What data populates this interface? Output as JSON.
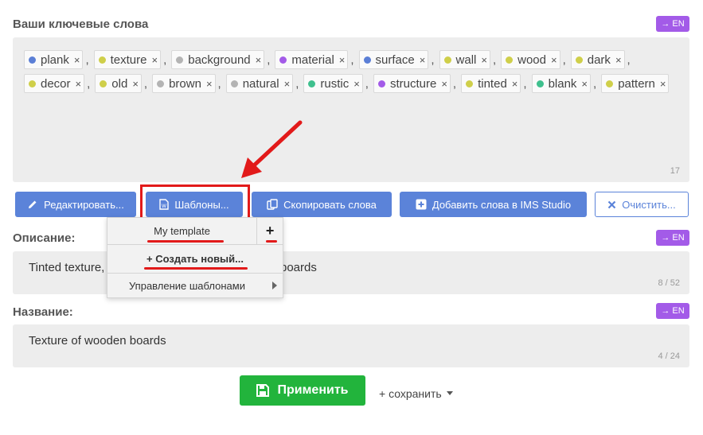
{
  "keywords_section": {
    "title": "Ваши ключевые слова",
    "lang_badge": "→ EN",
    "count": "17",
    "tags": [
      {
        "label": "plank",
        "color": "#5b7fd6"
      },
      {
        "label": "texture",
        "color": "#cfcf4a"
      },
      {
        "label": "background",
        "color": "#b4b4b4"
      },
      {
        "label": "material",
        "color": "#a35be8"
      },
      {
        "label": "surface",
        "color": "#5b7fd6"
      },
      {
        "label": "wall",
        "color": "#cfcf4a"
      },
      {
        "label": "wood",
        "color": "#cfcf4a"
      },
      {
        "label": "dark",
        "color": "#cfcf4a"
      },
      {
        "label": "decor",
        "color": "#cfcf4a"
      },
      {
        "label": "old",
        "color": "#cfcf4a"
      },
      {
        "label": "brown",
        "color": "#b4b4b4"
      },
      {
        "label": "natural",
        "color": "#b4b4b4"
      },
      {
        "label": "rustic",
        "color": "#3fc08e"
      },
      {
        "label": "structure",
        "color": "#a35be8"
      },
      {
        "label": "tinted",
        "color": "#cfcf4a"
      },
      {
        "label": "blank",
        "color": "#3fc08e"
      },
      {
        "label": "pattern",
        "color": "#cfcf4a"
      }
    ]
  },
  "toolbar": {
    "edit_label": "Редактировать...",
    "templates_label": "Шаблоны...",
    "copy_label": "Скопировать слова",
    "add_ims_label": "Добавить слова в IMS Studio",
    "clear_label": "Очистить..."
  },
  "templates_menu": {
    "template_name": "My template",
    "add_symbol": "+",
    "create_new": "+ Создать новый...",
    "manage": "Управление шаблонами"
  },
  "description_section": {
    "title": "Описание:",
    "lang_badge": "→ EN",
    "value_start": "Tinted texture,",
    "value_end": "boards",
    "count": "8 / 52"
  },
  "name_section": {
    "title": "Название:",
    "lang_badge": "→ EN",
    "value": "Texture of wooden boards",
    "count": "4 / 24"
  },
  "footer": {
    "apply_label": "Применить",
    "save_label": "+ сохранить"
  },
  "colors": {
    "accent_blue": "#5b83d9",
    "badge_purple": "#a35be8",
    "apply_green": "#22b43c",
    "annotation_red": "#e21a1a"
  }
}
